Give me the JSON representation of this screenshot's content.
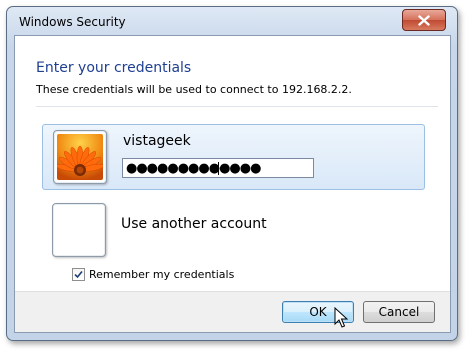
{
  "window": {
    "title": "Windows Security"
  },
  "header": {
    "title": "Enter your credentials",
    "description": "These credentials will be used to connect to 192.168.2.2."
  },
  "accounts": [
    {
      "username": "vistageek",
      "password_value": "●●●●●●●●●●●●●",
      "selected": true,
      "tile_icon": "orange-flower-icon"
    },
    {
      "label": "Use another account",
      "selected": false,
      "tile_icon": "blank-user-tile-icon"
    }
  ],
  "remember": {
    "label": "Remember my credentials",
    "checked": true
  },
  "buttons": {
    "ok_label": "OK",
    "cancel_label": "Cancel"
  },
  "colors": {
    "heading": "#1f3f91",
    "selection": "#d9e8f8",
    "close_button": "#c9563e"
  }
}
